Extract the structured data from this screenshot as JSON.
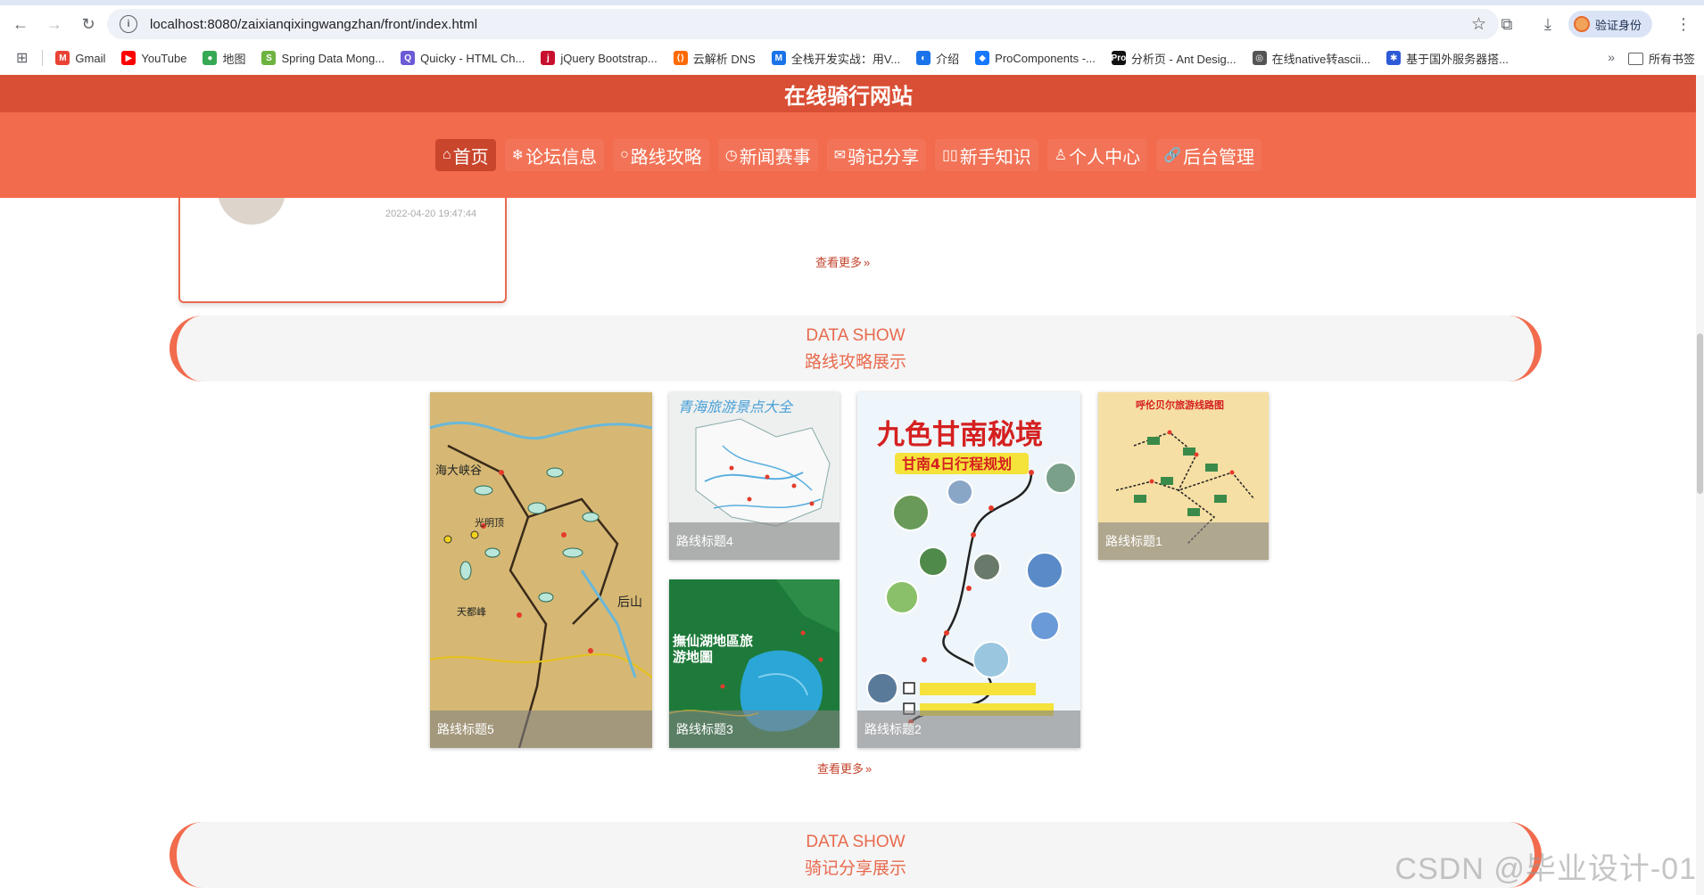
{
  "browser": {
    "url": "localhost:8080/zaixianqixingwangzhan/front/index.html",
    "verify_label": "验证身份",
    "bookmarks": [
      {
        "label": "Gmail",
        "color": "#ea4335",
        "glyph": "M"
      },
      {
        "label": "YouTube",
        "color": "#ff0000",
        "glyph": "▶"
      },
      {
        "label": "地图",
        "color": "#34a853",
        "glyph": "●"
      },
      {
        "label": "Spring Data Mong...",
        "color": "#6db33f",
        "glyph": "S"
      },
      {
        "label": "Quicky - HTML Ch...",
        "color": "#6b5bd6",
        "glyph": "Q"
      },
      {
        "label": "jQuery Bootstrap...",
        "color": "#c8102e",
        "glyph": "j"
      },
      {
        "label": "云解析 DNS",
        "color": "#ff6a00",
        "glyph": "⟨⟩"
      },
      {
        "label": "全栈开发实战：用V...",
        "color": "#1a73e8",
        "glyph": "M"
      },
      {
        "label": "介绍",
        "color": "#1a73e8",
        "glyph": "◐"
      },
      {
        "label": "ProComponents -...",
        "color": "#1677ff",
        "glyph": "◆"
      },
      {
        "label": "分析页 - Ant Desig...",
        "color": "#111111",
        "glyph": "Pro"
      },
      {
        "label": "在线native转ascii...",
        "color": "#555555",
        "glyph": "◎"
      },
      {
        "label": "基于国外服务器搭...",
        "color": "#2d5bd8",
        "glyph": "✱"
      }
    ],
    "all_bookmarks_label": "所有书签"
  },
  "site": {
    "title": "在线骑行网站",
    "nav": [
      {
        "icon": "⌂",
        "label": "首页",
        "active": true
      },
      {
        "icon": "❄",
        "label": "论坛信息",
        "active": false
      },
      {
        "icon": "○",
        "label": "路线攻略",
        "active": false
      },
      {
        "icon": "◷",
        "label": "新闻赛事",
        "active": false
      },
      {
        "icon": "✉",
        "label": "骑记分享",
        "active": false
      },
      {
        "icon": "▯▯",
        "label": "新手知识",
        "active": false
      },
      {
        "icon": "♙",
        "label": "个人中心",
        "active": false
      },
      {
        "icon": "🔗",
        "label": "后台管理",
        "active": false
      }
    ]
  },
  "forum_card": {
    "date": "2022-04-20 19:47:44"
  },
  "more_label": "查看更多",
  "route_section": {
    "en": "DATA SHOW",
    "zh": "路线攻略展示",
    "items": [
      {
        "caption": "路线标题5",
        "art_text": "海大峡谷"
      },
      {
        "caption": "路线标题4",
        "art_text": "青海旅游景点大全"
      },
      {
        "caption": "路线标题3",
        "art_text": "撫仙湖地區旅游地圖"
      },
      {
        "caption": "路线标题2",
        "art_text": "九色甘南秘境",
        "art_sub": "甘南4日行程规划"
      },
      {
        "caption": "路线标题1",
        "art_text": "呼伦贝尔旅游线路图"
      }
    ]
  },
  "share_section": {
    "en": "DATA SHOW",
    "zh": "骑记分享展示"
  },
  "watermark": "CSDN @毕业设计-01"
}
